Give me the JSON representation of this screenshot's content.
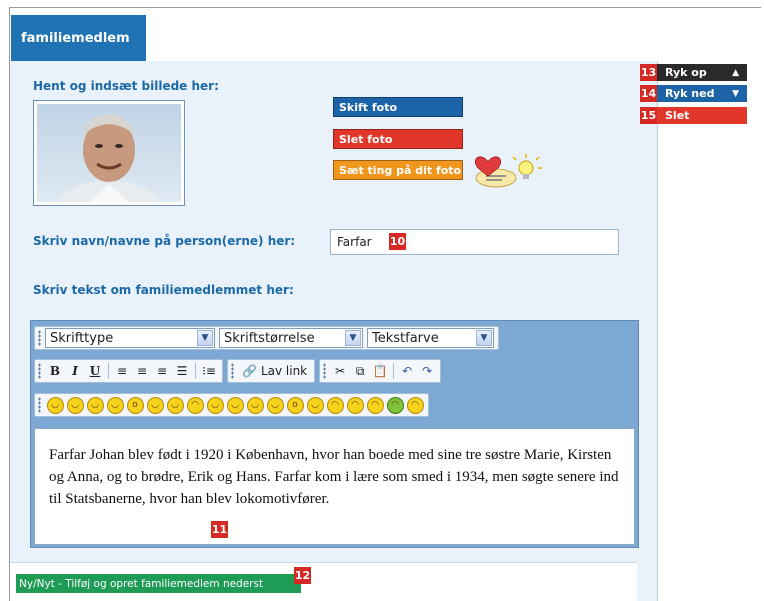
{
  "tab": {
    "label": "familiemedlem"
  },
  "photo_section": {
    "heading": "Hent og indsæt billede her:"
  },
  "photo_buttons": {
    "change": "Skift foto",
    "delete": "Slet foto",
    "decorate": "Sæt ting på dit foto"
  },
  "name_section": {
    "label": "Skriv navn/navne på person(erne) her:",
    "value": "Farfar"
  },
  "text_section": {
    "heading": "Skriv tekst om familiemedlemmet her:"
  },
  "editor": {
    "font_select": "Skrifttype",
    "size_select": "Skriftstørrelse",
    "color_select": "Tekstfarve",
    "format_buttons": {
      "bold": "B",
      "italic": "I",
      "underline": "U"
    },
    "link_label": "Lav link",
    "content": "Farfar Johan blev født i 1920 i København, hvor han boede med sine tre søstre Marie, Kirsten og Anna, og to brødre, Erik og Hans. Farfar kom i lære som smed i 1934, men søgte senere ind til Statsbanerne, hvor han blev lokomotivfører."
  },
  "add_member": {
    "label": "Ny/Nyt - Tilføj og opret familiemedlem nederst"
  },
  "side_buttons": {
    "up": "Ryk op",
    "down": "Ryk ned",
    "delete": "Slet"
  },
  "badges": {
    "name": "10",
    "text": "11",
    "add": "12",
    "up": "13",
    "down": "14",
    "delete": "15"
  },
  "icons": [
    "heart-icon",
    "lightbulb-icon",
    "link-icon",
    "cut-icon",
    "copy-icon",
    "paste-icon",
    "undo-icon",
    "redo-icon",
    "smiley-icon"
  ],
  "colors": {
    "tab_blue": "#1f73b3",
    "label_blue": "#1c6aa8",
    "change_button": "#1d63a8",
    "delete_button": "#e0372a",
    "decorate_button": "#f0961c",
    "add_green": "#1e9b54",
    "up_dark": "#2a2a2a",
    "down_blue": "#1d63a8",
    "slet_red": "#e0372a"
  }
}
